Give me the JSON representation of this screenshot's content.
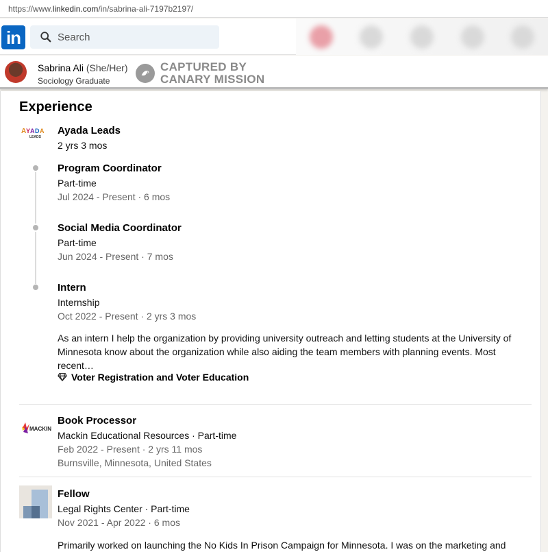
{
  "browser": {
    "url_prefix": "https://www.",
    "url_domain": "linkedin.com",
    "url_path": "/in/sabrina-ali-7197b2197/"
  },
  "nav": {
    "logo_text": "in",
    "search_placeholder": "Search"
  },
  "profile": {
    "name": "Sabrina Ali",
    "pronouns": "(She/Her)",
    "headline": "Sociology Graduate"
  },
  "watermark": {
    "line1": "CAPTURED BY",
    "line2": "CANARY MISSION"
  },
  "experience": {
    "title": "Experience",
    "ayada": {
      "company": "Ayada Leads",
      "duration": "2 yrs 3 mos",
      "roles": [
        {
          "title": "Program Coordinator",
          "type": "Part-time",
          "dates": "Jul 2024 - Present · 6 mos"
        },
        {
          "title": "Social Media Coordinator",
          "type": "Part-time",
          "dates": "Jun 2024 - Present · 7 mos"
        },
        {
          "title": "Intern",
          "type": "Internship",
          "dates": "Oct 2022 - Present · 2 yrs 3 mos",
          "description": "As an intern I help the organization by providing university outreach and letting students at the University of Minnesota know about the organization while also aiding the team members with planning events. Most recent…",
          "skill": "Voter Registration and Voter Education"
        }
      ]
    },
    "mackin": {
      "title": "Book Processor",
      "company": "Mackin Educational Resources · Part-time",
      "dates": "Feb 2022 - Present · 2 yrs 11 mos",
      "location": "Burnsville, Minnesota, United States",
      "logo_text": "MACKIN"
    },
    "fellow": {
      "title": "Fellow",
      "company": "Legal Rights Center · Part-time",
      "dates": "Nov 2021 - Apr 2022 · 6 mos",
      "description": "Primarily worked on launching the No Kids In Prison Campaign for Minnesota. I was on the marketing and"
    }
  },
  "colors": {
    "linkedin_blue": "#0a66c2",
    "muted_text": "#666666",
    "search_bg": "#edf3f8"
  }
}
